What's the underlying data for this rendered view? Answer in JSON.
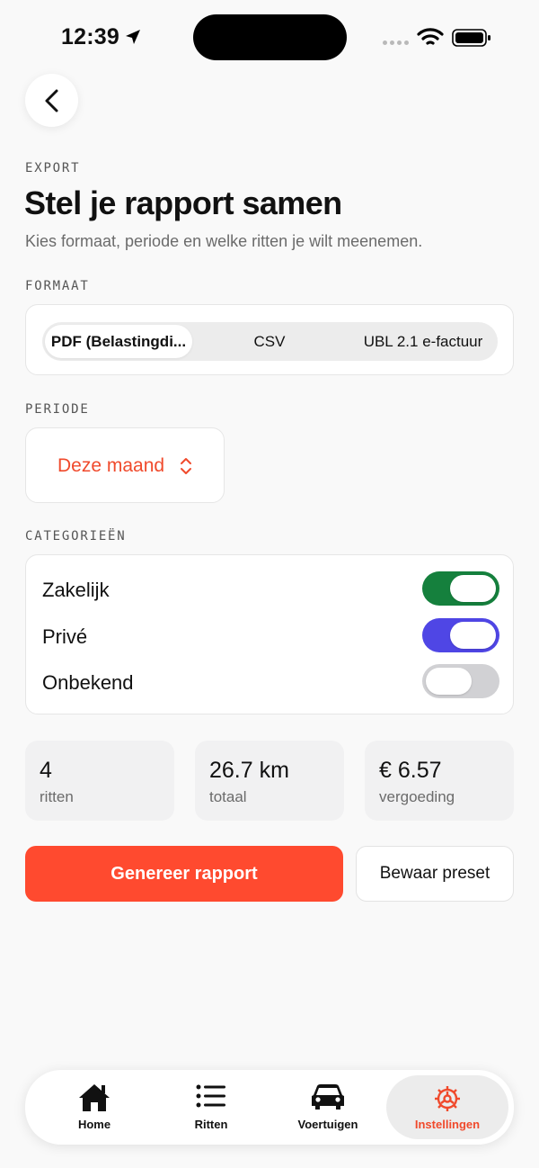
{
  "status_bar": {
    "time": "12:39"
  },
  "header": {
    "eyebrow": "EXPORT",
    "title": "Stel je rapport samen",
    "subtitle": "Kies formaat, periode en welke ritten je wilt meenemen."
  },
  "format": {
    "section_label": "FORMAAT",
    "options": [
      "PDF (Belastingdi...",
      "CSV",
      "UBL 2.1 e-factuur"
    ],
    "selected_index": 0
  },
  "period": {
    "section_label": "PERIODE",
    "value": "Deze maand"
  },
  "categories": {
    "section_label": "CATEGORIEËN",
    "items": [
      {
        "label": "Zakelijk",
        "on": true,
        "color": "#15803d"
      },
      {
        "label": "Privé",
        "on": true,
        "color": "#4f46e5"
      },
      {
        "label": "Onbekend",
        "on": false,
        "color": "#d1d1d4"
      }
    ]
  },
  "stats": [
    {
      "value": "4",
      "label": "ritten"
    },
    {
      "value": "26.7 km",
      "label": "totaal"
    },
    {
      "value": "€ 6.57",
      "label": "vergoeding"
    }
  ],
  "actions": {
    "primary": "Genereer rapport",
    "secondary": "Bewaar preset"
  },
  "tabbar": {
    "items": [
      {
        "label": "Home",
        "icon": "home-icon"
      },
      {
        "label": "Ritten",
        "icon": "list-icon"
      },
      {
        "label": "Voertuigen",
        "icon": "car-icon"
      },
      {
        "label": "Instellingen",
        "icon": "gear-icon"
      }
    ],
    "active_index": 3
  },
  "colors": {
    "accent": "#ff4a2f",
    "accent_text": "#f04a2c"
  }
}
